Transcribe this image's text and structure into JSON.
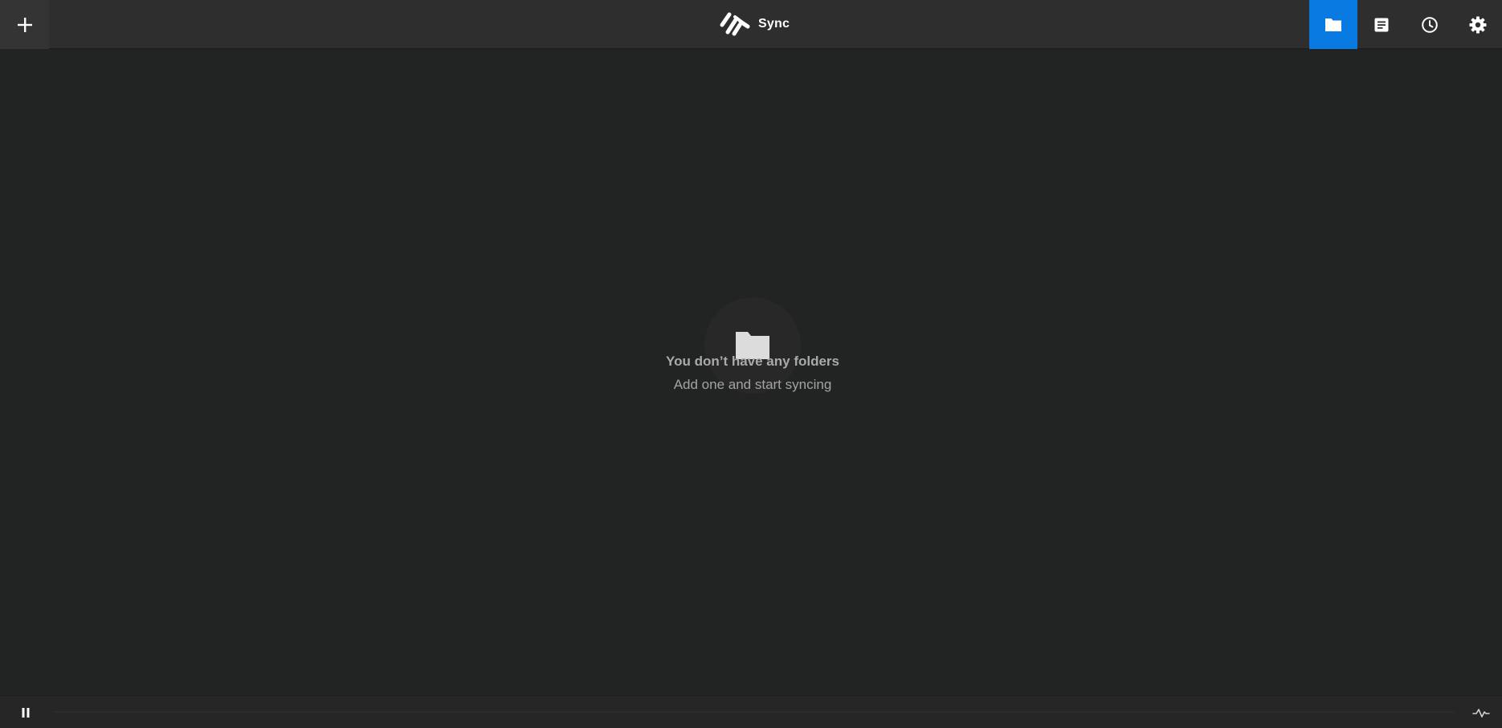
{
  "app": {
    "name": "Sync",
    "logo_icon": "resilio-logo-icon"
  },
  "header": {
    "add_button_icon": "plus-icon",
    "nav": [
      {
        "id": "folders",
        "icon": "folder-icon",
        "active": true
      },
      {
        "id": "transfers",
        "icon": "document-list-icon",
        "active": false
      },
      {
        "id": "history",
        "icon": "clock-icon",
        "active": false
      },
      {
        "id": "settings",
        "icon": "gear-icon",
        "active": false
      }
    ]
  },
  "empty_state": {
    "icon": "folder-icon",
    "title": "You don’t have any folders",
    "subtitle": "Add one and start syncing"
  },
  "footer": {
    "pause_icon": "pause-icon",
    "activity_icon": "activity-pulse-icon"
  },
  "colors": {
    "accent": "#0a7ae3",
    "background": "#222323",
    "topbar": "#2e2e2e"
  }
}
